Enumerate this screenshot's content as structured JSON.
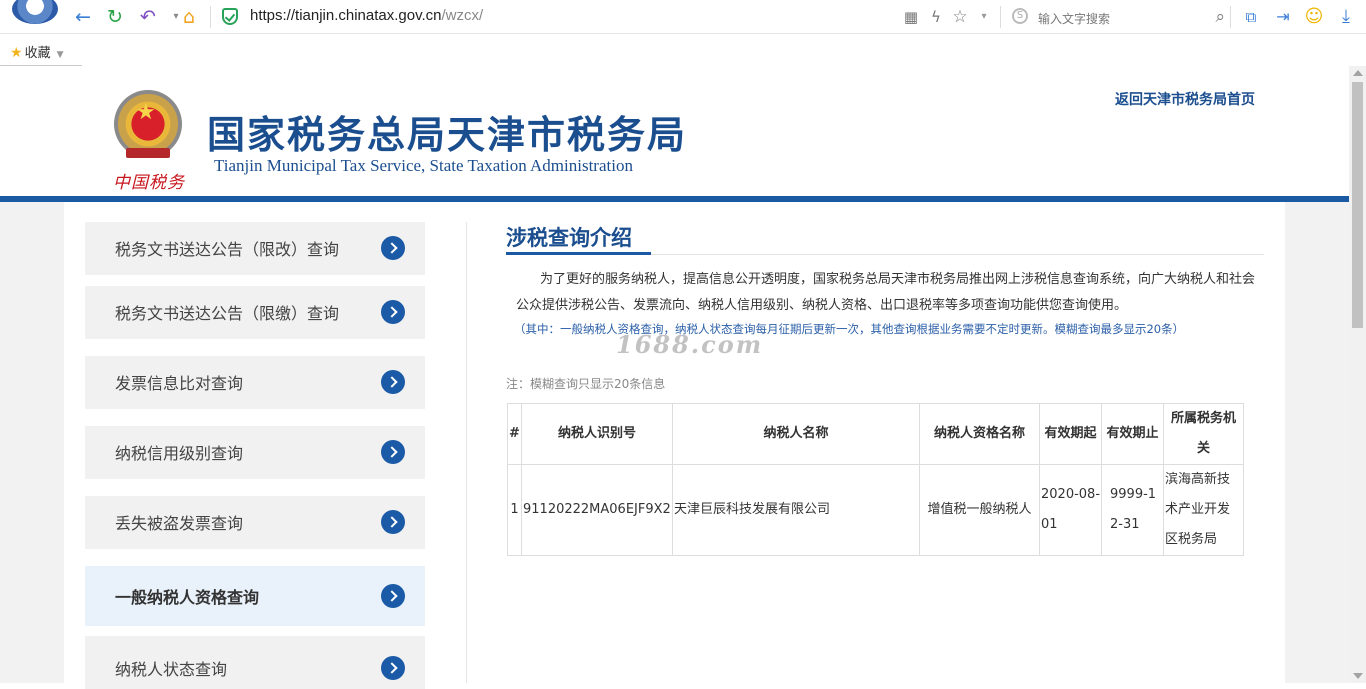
{
  "browser": {
    "url_host": "https://tianjin.chinatax.gov.cn",
    "url_path": "/wzcx/",
    "search_placeholder": "输入文字搜索",
    "favorites_label": "收藏"
  },
  "header": {
    "emblem_signature": "中国税务",
    "title_cn": "国家税务总局天津市税务局",
    "title_en": "Tianjin Municipal Tax Service, State Taxation Administration",
    "home_link": "返回天津市税务局首页"
  },
  "sidebar": {
    "items": [
      {
        "label": "税务文书送达公告（限改）查询",
        "active": false
      },
      {
        "label": "税务文书送达公告（限缴）查询",
        "active": false
      },
      {
        "label": "发票信息比对查询",
        "active": false
      },
      {
        "label": "纳税信用级别查询",
        "active": false
      },
      {
        "label": "丢失被盗发票查询",
        "active": false
      },
      {
        "label": "一般纳税人资格查询",
        "active": true
      },
      {
        "label": "纳税人状态查询",
        "active": false
      }
    ]
  },
  "main": {
    "section_title": "涉税查询介绍",
    "intro": "为了更好的服务纳税人，提高信息公开透明度，国家税务总局天津市税务局推出网上涉税信息查询系统，向广大纳税人和社会公众提供涉税公告、发票流向、纳税人信用级别、纳税人资格、出口退税率等多项查询功能供您查询使用。",
    "note_blue": "（其中：一般纳税人资格查询，纳税人状态查询每月征期后更新一次，其他查询根据业务需要不定时更新。模糊查询最多显示20条）",
    "watermark": "1688.com",
    "note_gray": "注：模糊查询只显示20条信息"
  },
  "table": {
    "headers": [
      "#",
      "纳税人识别号",
      "纳税人名称",
      "纳税人资格名称",
      "有效期起",
      "有效期止",
      "所属税务机关"
    ],
    "rows": [
      {
        "index": "1",
        "tax_id": "91120222MA06EJF9X2",
        "name": "天津巨辰科技发展有限公司",
        "qualification": "增值税一般纳税人",
        "valid_from": "2020-08-01",
        "valid_to": "9999-12-31",
        "tax_office": "滨海高新技术产业开发区税务局"
      }
    ]
  },
  "colors": {
    "brand_blue": "#1b4e8f",
    "header_bar": "#1a5aa2",
    "arrow_bg": "#1b5aa6",
    "emblem_red": "#c8161d"
  }
}
